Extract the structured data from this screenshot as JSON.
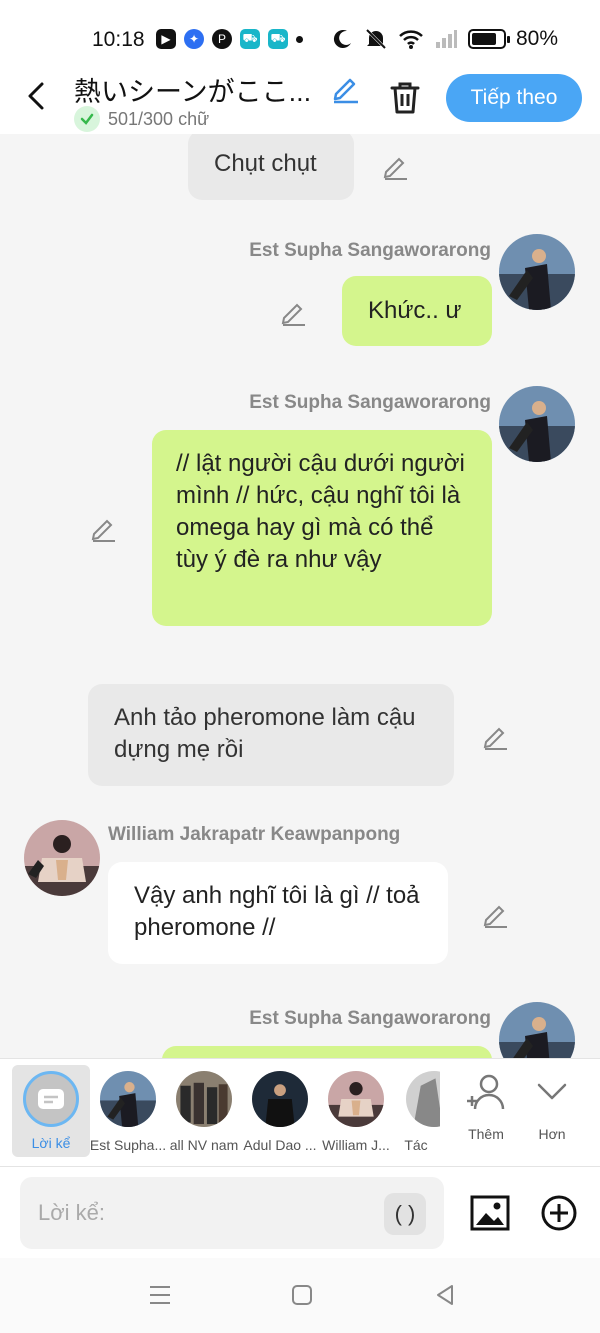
{
  "status": {
    "time": "10:18",
    "battery": "80%",
    "battery_fraction": 0.8,
    "apps": [
      "video-app-icon",
      "messenger-icon",
      "pinterest-icon",
      "shop-icon",
      "shop-icon",
      "dot-icon"
    ],
    "status_icons": [
      "moon-icon",
      "mute-icon",
      "wifi-icon",
      "signal-icon",
      "battery-icon"
    ]
  },
  "header": {
    "title": "熱いシーンがここ...",
    "count": "501/300 chữ",
    "next_label": "Tiếp theo"
  },
  "messages": [
    {
      "type": "narration",
      "text": "Chụt chụt"
    },
    {
      "type": "right",
      "name": "Est Supha Sangaworarong",
      "text": "Khức.. ư"
    },
    {
      "type": "right",
      "name": "Est Supha Sangaworarong",
      "text": "// lật người cậu dưới người mình // hức, cậu nghĩ tôi là omega  hay gì mà có thể tùy ý đè ra như vậy"
    },
    {
      "type": "narration",
      "text": "Anh tảo pheromone làm cậu dựng mẹ rồi"
    },
    {
      "type": "left",
      "name": "William Jakrapatr Keawpanpong",
      "text": "Vậy anh nghĩ tôi là gì // toả pheromone //"
    },
    {
      "type": "right",
      "name": "Est Supha Sangaworarong",
      "text": ""
    }
  ],
  "characters": {
    "narration_label": "Lời kể",
    "items": [
      {
        "label": "Est Supha..."
      },
      {
        "label": "all NV nam"
      },
      {
        "label": "Adul Dao ..."
      },
      {
        "label": "William J..."
      },
      {
        "label": "Tác"
      }
    ],
    "add_label": "Thêm",
    "more_label": "Hơn"
  },
  "input": {
    "placeholder": "Lời kể:",
    "paren_label": "( )"
  },
  "colors": {
    "accent": "#4aa6f5",
    "bubble_right": "#d4f58d",
    "bubble_narration": "#e9e9e9",
    "bubble_left": "#ffffff"
  }
}
